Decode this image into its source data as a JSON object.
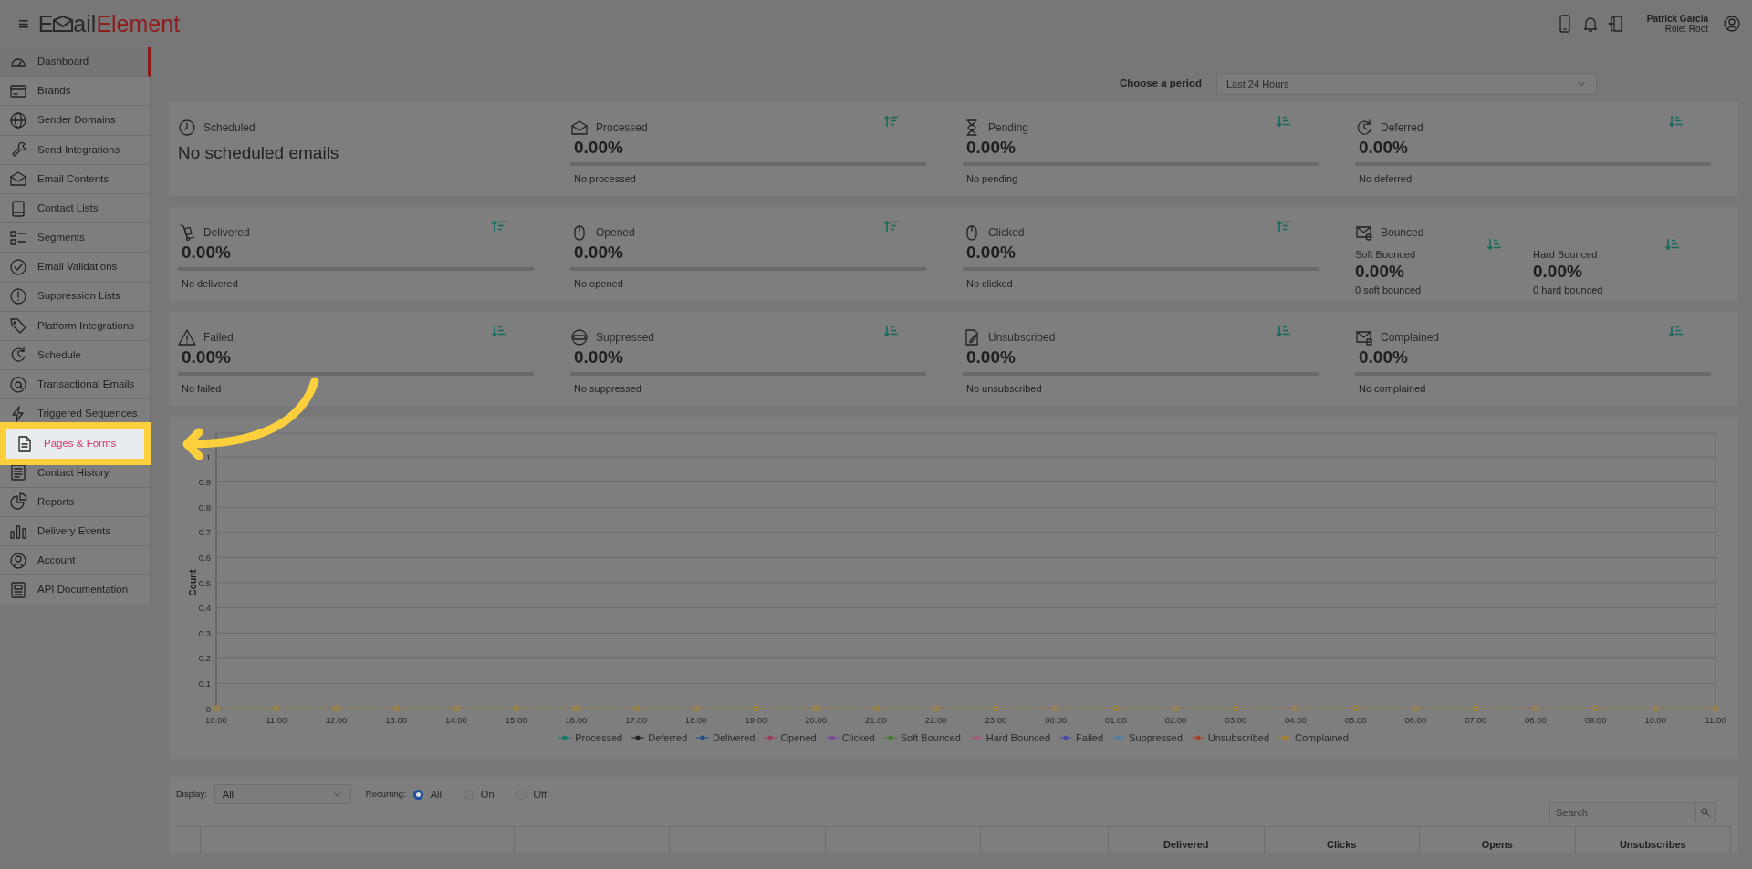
{
  "header": {
    "menu_icon": "≡",
    "logo": {
      "prefix": "E",
      "middle": "ail",
      "accent": "Element"
    },
    "user": {
      "name": "Patrick Garcia",
      "role": "Role: Root"
    }
  },
  "sidebar": {
    "items": [
      {
        "label": "Dashboard",
        "selected": true,
        "highlighted": false
      },
      {
        "label": "Brands",
        "selected": false,
        "highlighted": false
      },
      {
        "label": "Sender Domains",
        "selected": false,
        "highlighted": false
      },
      {
        "label": "Send Integrations",
        "selected": false,
        "highlighted": false
      },
      {
        "label": "Email Contents",
        "selected": false,
        "highlighted": false
      },
      {
        "label": "Contact Lists",
        "selected": false,
        "highlighted": false
      },
      {
        "label": "Segments",
        "selected": false,
        "highlighted": false
      },
      {
        "label": "Email Validations",
        "selected": false,
        "highlighted": false
      },
      {
        "label": "Suppression Lists",
        "selected": false,
        "highlighted": false
      },
      {
        "label": "Platform Integrations",
        "selected": false,
        "highlighted": false
      },
      {
        "label": "Schedule",
        "selected": false,
        "highlighted": false
      },
      {
        "label": "Transactional Emails",
        "selected": false,
        "highlighted": false
      },
      {
        "label": "Triggered Sequences",
        "selected": false,
        "highlighted": false
      },
      {
        "label": "Pages & Forms",
        "selected": false,
        "highlighted": true
      },
      {
        "label": "Contact History",
        "selected": false,
        "highlighted": false
      },
      {
        "label": "Reports",
        "selected": false,
        "highlighted": false
      },
      {
        "label": "Delivery Events",
        "selected": false,
        "highlighted": false
      },
      {
        "label": "Account",
        "selected": false,
        "highlighted": false
      },
      {
        "label": "API Documentation",
        "selected": false,
        "highlighted": false
      }
    ]
  },
  "period": {
    "label": "Choose a period",
    "value": "Last 24 Hours"
  },
  "stat_rows": [
    {
      "cards": [
        {
          "kind": "text",
          "title": "Scheduled",
          "text": "No scheduled emails"
        },
        {
          "kind": "stat",
          "title": "Processed",
          "sort_ascending": true,
          "value": "0.00%",
          "level": 0,
          "note": "No processed"
        },
        {
          "kind": "stat",
          "title": "Pending",
          "sort_ascending": false,
          "value": "0.00%",
          "level": 0,
          "note": "No pending"
        },
        {
          "kind": "stat",
          "title": "Deferred",
          "sort_ascending": false,
          "value": "0.00%",
          "level": 0,
          "note": "No deferred"
        }
      ]
    },
    {
      "cards": [
        {
          "kind": "stat",
          "title": "Delivered",
          "sort_ascending": true,
          "value": "0.00%",
          "level": 0,
          "note": "No delivered"
        },
        {
          "kind": "stat",
          "title": "Opened",
          "sort_ascending": true,
          "value": "0.00%",
          "level": 0,
          "note": "No opened"
        },
        {
          "kind": "stat",
          "title": "Clicked",
          "sort_ascending": true,
          "value": "0.00%",
          "level": 0,
          "note": "No clicked"
        },
        {
          "kind": "split",
          "title": "Bounced",
          "parts": [
            {
              "label": "Soft Bounced",
              "sort_ascending": false,
              "value": "0.00%",
              "note": "0 soft bounced"
            },
            {
              "label": "Hard Bounced",
              "sort_ascending": false,
              "value": "0.00%",
              "note": "0 hard bounced"
            }
          ]
        }
      ]
    },
    {
      "cards": [
        {
          "kind": "stat",
          "title": "Failed",
          "sort_ascending": false,
          "value": "0.00%",
          "level": 0,
          "note": "No failed"
        },
        {
          "kind": "stat",
          "title": "Suppressed",
          "sort_ascending": false,
          "value": "0.00%",
          "level": 0,
          "note": "No suppressed"
        },
        {
          "kind": "stat",
          "title": "Unsubscribed",
          "sort_ascending": false,
          "value": "0.00%",
          "level": 0,
          "note": "No unsubscribed"
        },
        {
          "kind": "stat",
          "title": "Complained",
          "sort_ascending": false,
          "value": "0.00%",
          "level": 0,
          "note": "No complained"
        }
      ]
    }
  ],
  "chart": {
    "chart_data": {
      "type": "line",
      "ylabel": "Count",
      "grid": true,
      "legend": true,
      "categories": [
        "10:00",
        "11:00",
        "12:00",
        "13:00",
        "14:00",
        "15:00",
        "16:00",
        "17:00",
        "18:00",
        "19:00",
        "20:00",
        "21:00",
        "22:00",
        "23:00",
        "00:00",
        "01:00",
        "02:00",
        "03:00",
        "04:00",
        "05:00",
        "06:00",
        "07:00",
        "08:00",
        "09:00",
        "10:00",
        "11:00"
      ],
      "ylim": [
        0,
        1
      ],
      "yticks": [
        0,
        0.1,
        0.2,
        0.3,
        0.4,
        0.5,
        0.6,
        0.7,
        0.8,
        0.9,
        1
      ],
      "series": [
        {
          "name": "Processed",
          "color": "#11786a",
          "marker": "circle",
          "values": [
            null,
            null,
            null,
            null,
            null,
            null,
            null,
            null,
            null,
            null,
            null,
            null,
            null,
            null,
            null,
            null,
            null,
            null,
            null,
            null,
            null,
            null,
            null,
            null,
            null,
            null
          ]
        },
        {
          "name": "Deferred",
          "color": "#222222",
          "marker": "circle",
          "values": [
            null,
            null,
            null,
            null,
            null,
            null,
            null,
            null,
            null,
            null,
            null,
            null,
            null,
            null,
            null,
            null,
            null,
            null,
            null,
            null,
            null,
            null,
            null,
            null,
            null,
            null
          ]
        },
        {
          "name": "Delivered",
          "color": "#1f4f8a",
          "marker": "circle",
          "values": [
            null,
            null,
            null,
            null,
            null,
            null,
            null,
            null,
            null,
            null,
            null,
            null,
            null,
            null,
            null,
            null,
            null,
            null,
            null,
            null,
            null,
            null,
            null,
            null,
            null,
            null
          ]
        },
        {
          "name": "Opened",
          "color": "#a03c5c",
          "marker": "circle",
          "values": [
            null,
            null,
            null,
            null,
            null,
            null,
            null,
            null,
            null,
            null,
            null,
            null,
            null,
            null,
            null,
            null,
            null,
            null,
            null,
            null,
            null,
            null,
            null,
            null,
            null,
            null
          ]
        },
        {
          "name": "Clicked",
          "color": "#7a4a9a",
          "marker": "circle",
          "values": [
            null,
            null,
            null,
            null,
            null,
            null,
            null,
            null,
            null,
            null,
            null,
            null,
            null,
            null,
            null,
            null,
            null,
            null,
            null,
            null,
            null,
            null,
            null,
            null,
            null,
            null
          ]
        },
        {
          "name": "Soft Bounced",
          "color": "#3f7a2a",
          "marker": "circle",
          "values": [
            null,
            null,
            null,
            null,
            null,
            null,
            null,
            null,
            null,
            null,
            null,
            null,
            null,
            null,
            null,
            null,
            null,
            null,
            null,
            null,
            null,
            null,
            null,
            null,
            null,
            null
          ]
        },
        {
          "name": "Hard Bounced",
          "color": "#a8567c",
          "marker": "circle",
          "values": [
            null,
            null,
            null,
            null,
            null,
            null,
            null,
            null,
            null,
            null,
            null,
            null,
            null,
            null,
            null,
            null,
            null,
            null,
            null,
            null,
            null,
            null,
            null,
            null,
            null,
            null
          ]
        },
        {
          "name": "Failed",
          "color": "#4a4aa8",
          "marker": "circle",
          "values": [
            null,
            null,
            null,
            null,
            null,
            null,
            null,
            null,
            null,
            null,
            null,
            null,
            null,
            null,
            null,
            null,
            null,
            null,
            null,
            null,
            null,
            null,
            null,
            null,
            null,
            null
          ]
        },
        {
          "name": "Suppressed",
          "color": "#4a7fa8",
          "marker": "circle",
          "values": [
            null,
            null,
            null,
            null,
            null,
            null,
            null,
            null,
            null,
            null,
            null,
            null,
            null,
            null,
            null,
            null,
            null,
            null,
            null,
            null,
            null,
            null,
            null,
            null,
            null,
            null
          ]
        },
        {
          "name": "Unsubscribed",
          "color": "#a8442a",
          "marker": "circle",
          "values": [
            null,
            null,
            null,
            null,
            null,
            null,
            null,
            null,
            null,
            null,
            null,
            null,
            null,
            null,
            null,
            null,
            null,
            null,
            null,
            null,
            null,
            null,
            null,
            null,
            null,
            null
          ]
        },
        {
          "name": "Complained",
          "color": "#a8842a",
          "marker": "circle",
          "values": [
            0,
            0,
            0,
            0,
            0,
            0,
            0,
            0,
            0,
            0,
            0,
            0,
            0,
            0,
            0,
            0,
            0,
            0,
            0,
            0,
            0,
            0,
            0,
            0,
            0,
            0
          ]
        }
      ]
    }
  },
  "filters": {
    "display": {
      "label": "Display:",
      "value": "All"
    },
    "recurring": {
      "label": "Recurring:",
      "options": [
        {
          "label": "All",
          "selected": true
        },
        {
          "label": "On",
          "selected": false
        },
        {
          "label": "Off",
          "selected": false
        }
      ]
    },
    "search": {
      "placeholder": "Search"
    }
  },
  "table": {
    "columns": [
      "Delivered",
      "Clicks",
      "Opens",
      "Unsubscribes"
    ]
  }
}
